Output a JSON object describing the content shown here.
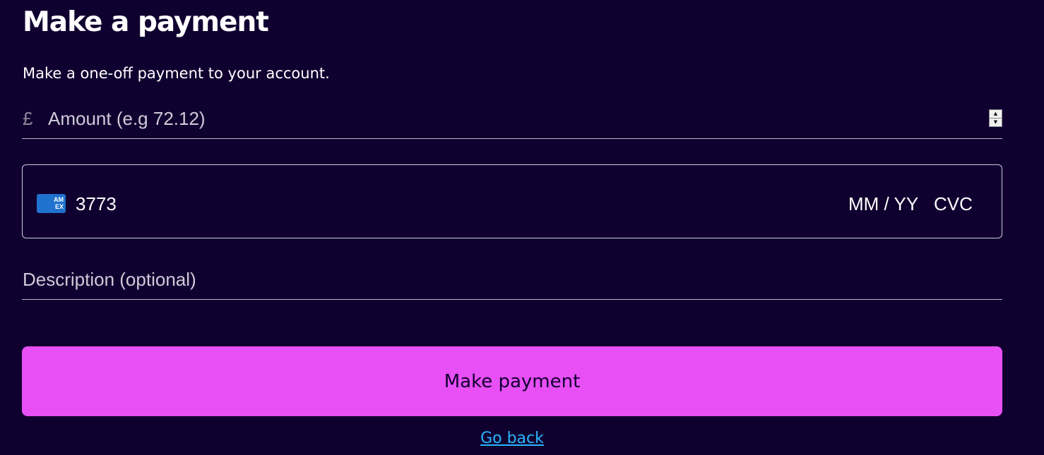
{
  "page": {
    "title": "Make a payment",
    "subtitle": "Make a one-off payment to your account."
  },
  "amount": {
    "currency_symbol": "£",
    "placeholder": "Amount (e.g 72.12)",
    "value": ""
  },
  "card": {
    "brand": "amex",
    "brand_lines": [
      "AM",
      "EX"
    ],
    "number": "3773",
    "expiry_placeholder": "MM / YY",
    "cvc_placeholder": "CVC"
  },
  "description": {
    "placeholder": "Description (optional)",
    "value": ""
  },
  "actions": {
    "submit_label": "Make payment",
    "back_label": "Go back"
  },
  "colors": {
    "background": "#100030",
    "button": "#e84ff5",
    "link": "#29b6ff",
    "card_brand": "#1f72cd"
  }
}
